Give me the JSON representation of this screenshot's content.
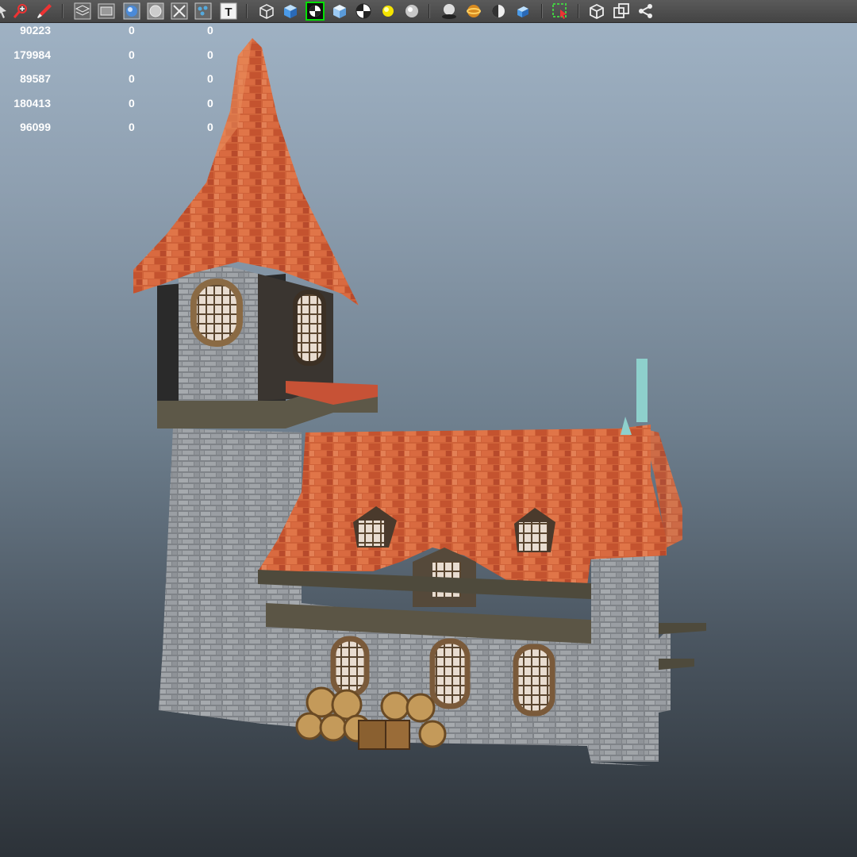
{
  "toolbar": {
    "buttons": [
      {
        "name": "select-arrow-icon",
        "active": false
      },
      {
        "name": "paint-select-icon",
        "active": false
      },
      {
        "name": "brush-tool-icon",
        "active": false
      },
      {
        "name": "wireframe-on-shaded-icon",
        "active": false
      },
      {
        "name": "film-gate-icon",
        "active": false
      },
      {
        "name": "smooth-shade-icon",
        "active": false
      },
      {
        "name": "flat-shade-icon",
        "active": false
      },
      {
        "name": "isolate-select-icon",
        "active": false
      },
      {
        "name": "uv-texture-icon",
        "active": false
      },
      {
        "name": "text-display-icon",
        "active": false
      },
      {
        "name": "wireframe-cube-icon",
        "active": false
      },
      {
        "name": "shaded-cube-icon",
        "active": false
      },
      {
        "name": "checker-texture-icon",
        "active": true
      },
      {
        "name": "textured-cube-icon",
        "active": false
      },
      {
        "name": "checker-sphere-icon",
        "active": false
      },
      {
        "name": "default-light-icon",
        "active": false
      },
      {
        "name": "all-lights-icon",
        "active": false
      },
      {
        "name": "shadows-icon",
        "active": false
      },
      {
        "name": "ambient-occlusion-icon",
        "active": false
      },
      {
        "name": "half-sphere-icon",
        "active": false
      },
      {
        "name": "xray-cube-icon",
        "active": false
      },
      {
        "name": "selection-highlight-icon",
        "active": false
      },
      {
        "name": "bounding-box-icon",
        "active": false
      },
      {
        "name": "backface-cube-icon",
        "active": false
      },
      {
        "name": "share-graph-icon",
        "active": false
      }
    ]
  },
  "hud": {
    "rows": [
      {
        "count": "90223",
        "col2": "0",
        "col3": "0"
      },
      {
        "count": "179984",
        "col2": "0",
        "col3": "0"
      },
      {
        "count": "89587",
        "col2": "0",
        "col3": "0"
      },
      {
        "count": "180413",
        "col2": "0",
        "col3": "0"
      },
      {
        "count": "96099",
        "col2": "0",
        "col3": "0"
      }
    ]
  },
  "colors": {
    "viewport_top": "#a1b4c6",
    "viewport_bottom": "#2c3238",
    "toolbar_bg": "#4e4e4e",
    "active_outline": "#00e000",
    "roof_tile": "#d0603a",
    "stone": "#9a9ea2",
    "timber": "#5a5242"
  },
  "scene": {
    "description_icon": "medieval-house-model"
  }
}
